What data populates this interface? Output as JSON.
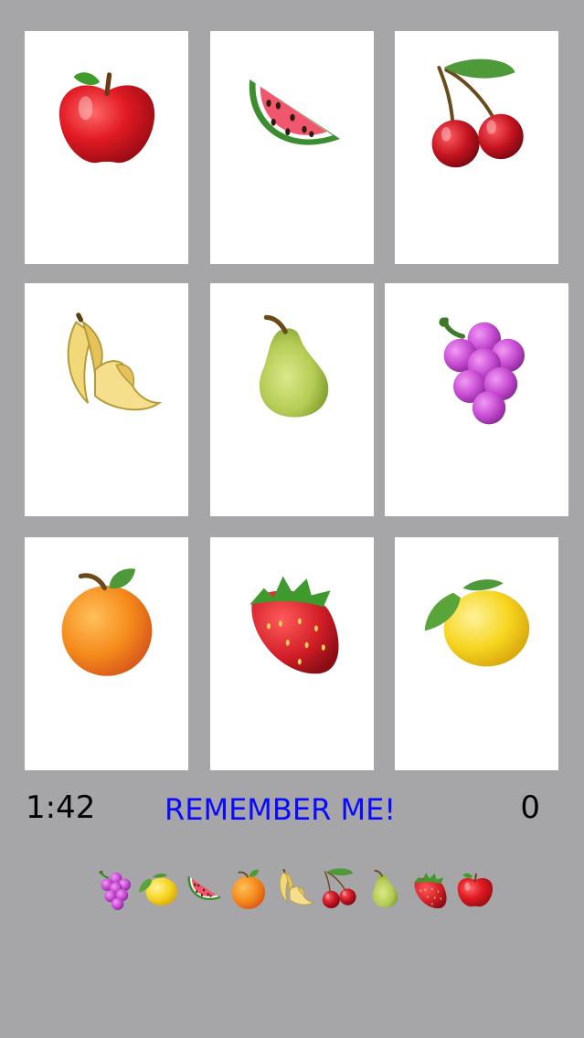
{
  "board": {
    "cards": [
      {
        "fruit": "apple-icon"
      },
      {
        "fruit": "watermelon-icon"
      },
      {
        "fruit": "cherries-icon"
      },
      {
        "fruit": "banana-icon"
      },
      {
        "fruit": "pear-icon"
      },
      {
        "fruit": "grapes-icon"
      },
      {
        "fruit": "orange-icon"
      },
      {
        "fruit": "strawberry-icon"
      },
      {
        "fruit": "lemon-icon"
      }
    ]
  },
  "status": {
    "timer": "1:42",
    "message": "REMEMBER ME!",
    "score": "0"
  },
  "sequence": [
    "grapes-icon",
    "lemon-icon",
    "watermelon-icon",
    "orange-icon",
    "banana-icon",
    "cherries-icon",
    "pear-icon",
    "strawberry-icon",
    "apple-icon"
  ],
  "colors": {
    "background": "#a6a5a8",
    "card": "#ffffff",
    "message": "#0a0aff"
  }
}
